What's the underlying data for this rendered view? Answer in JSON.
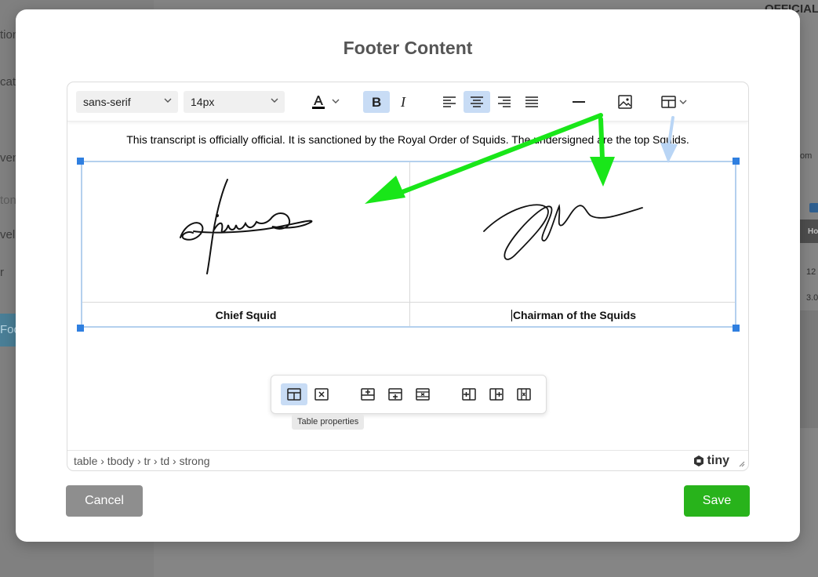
{
  "background": {
    "official_label": "OFFICIAL",
    "left_fragments": [
      "tion",
      "cat",
      "ven",
      "ton",
      "vel",
      "r"
    ],
    "left_button": "Foo",
    "right_header": "Ho",
    "right_fragments": [
      "om",
      "12",
      "3.0"
    ]
  },
  "modal": {
    "title": "Footer Content"
  },
  "toolbar": {
    "font_family": "sans-serif",
    "font_size": "14px",
    "icons": [
      "text-color-icon",
      "bold-icon",
      "italic-icon",
      "align-left-icon",
      "align-center-icon",
      "align-right-icon",
      "justify-icon",
      "horizontal-rule-icon",
      "image-icon",
      "table-icon"
    ]
  },
  "content": {
    "paragraph": "This transcript is officially official.  It is sanctioned by the Royal Order of Squids.  The undersigned are the top Squids.",
    "captions": [
      "Chief Squid",
      "Chairman of the Squids"
    ]
  },
  "context_toolbar": {
    "tooltip": "Table properties"
  },
  "statusbar": {
    "path": "table › tbody › tr › td › strong",
    "brand": "tiny"
  },
  "buttons": {
    "cancel": "Cancel",
    "save": "Save"
  },
  "colors": {
    "save": "#28b31b",
    "cancel": "#8e8e8e",
    "selection": "#b4d0ee",
    "handle": "#2f7fe0",
    "arrow": "#19e619"
  }
}
